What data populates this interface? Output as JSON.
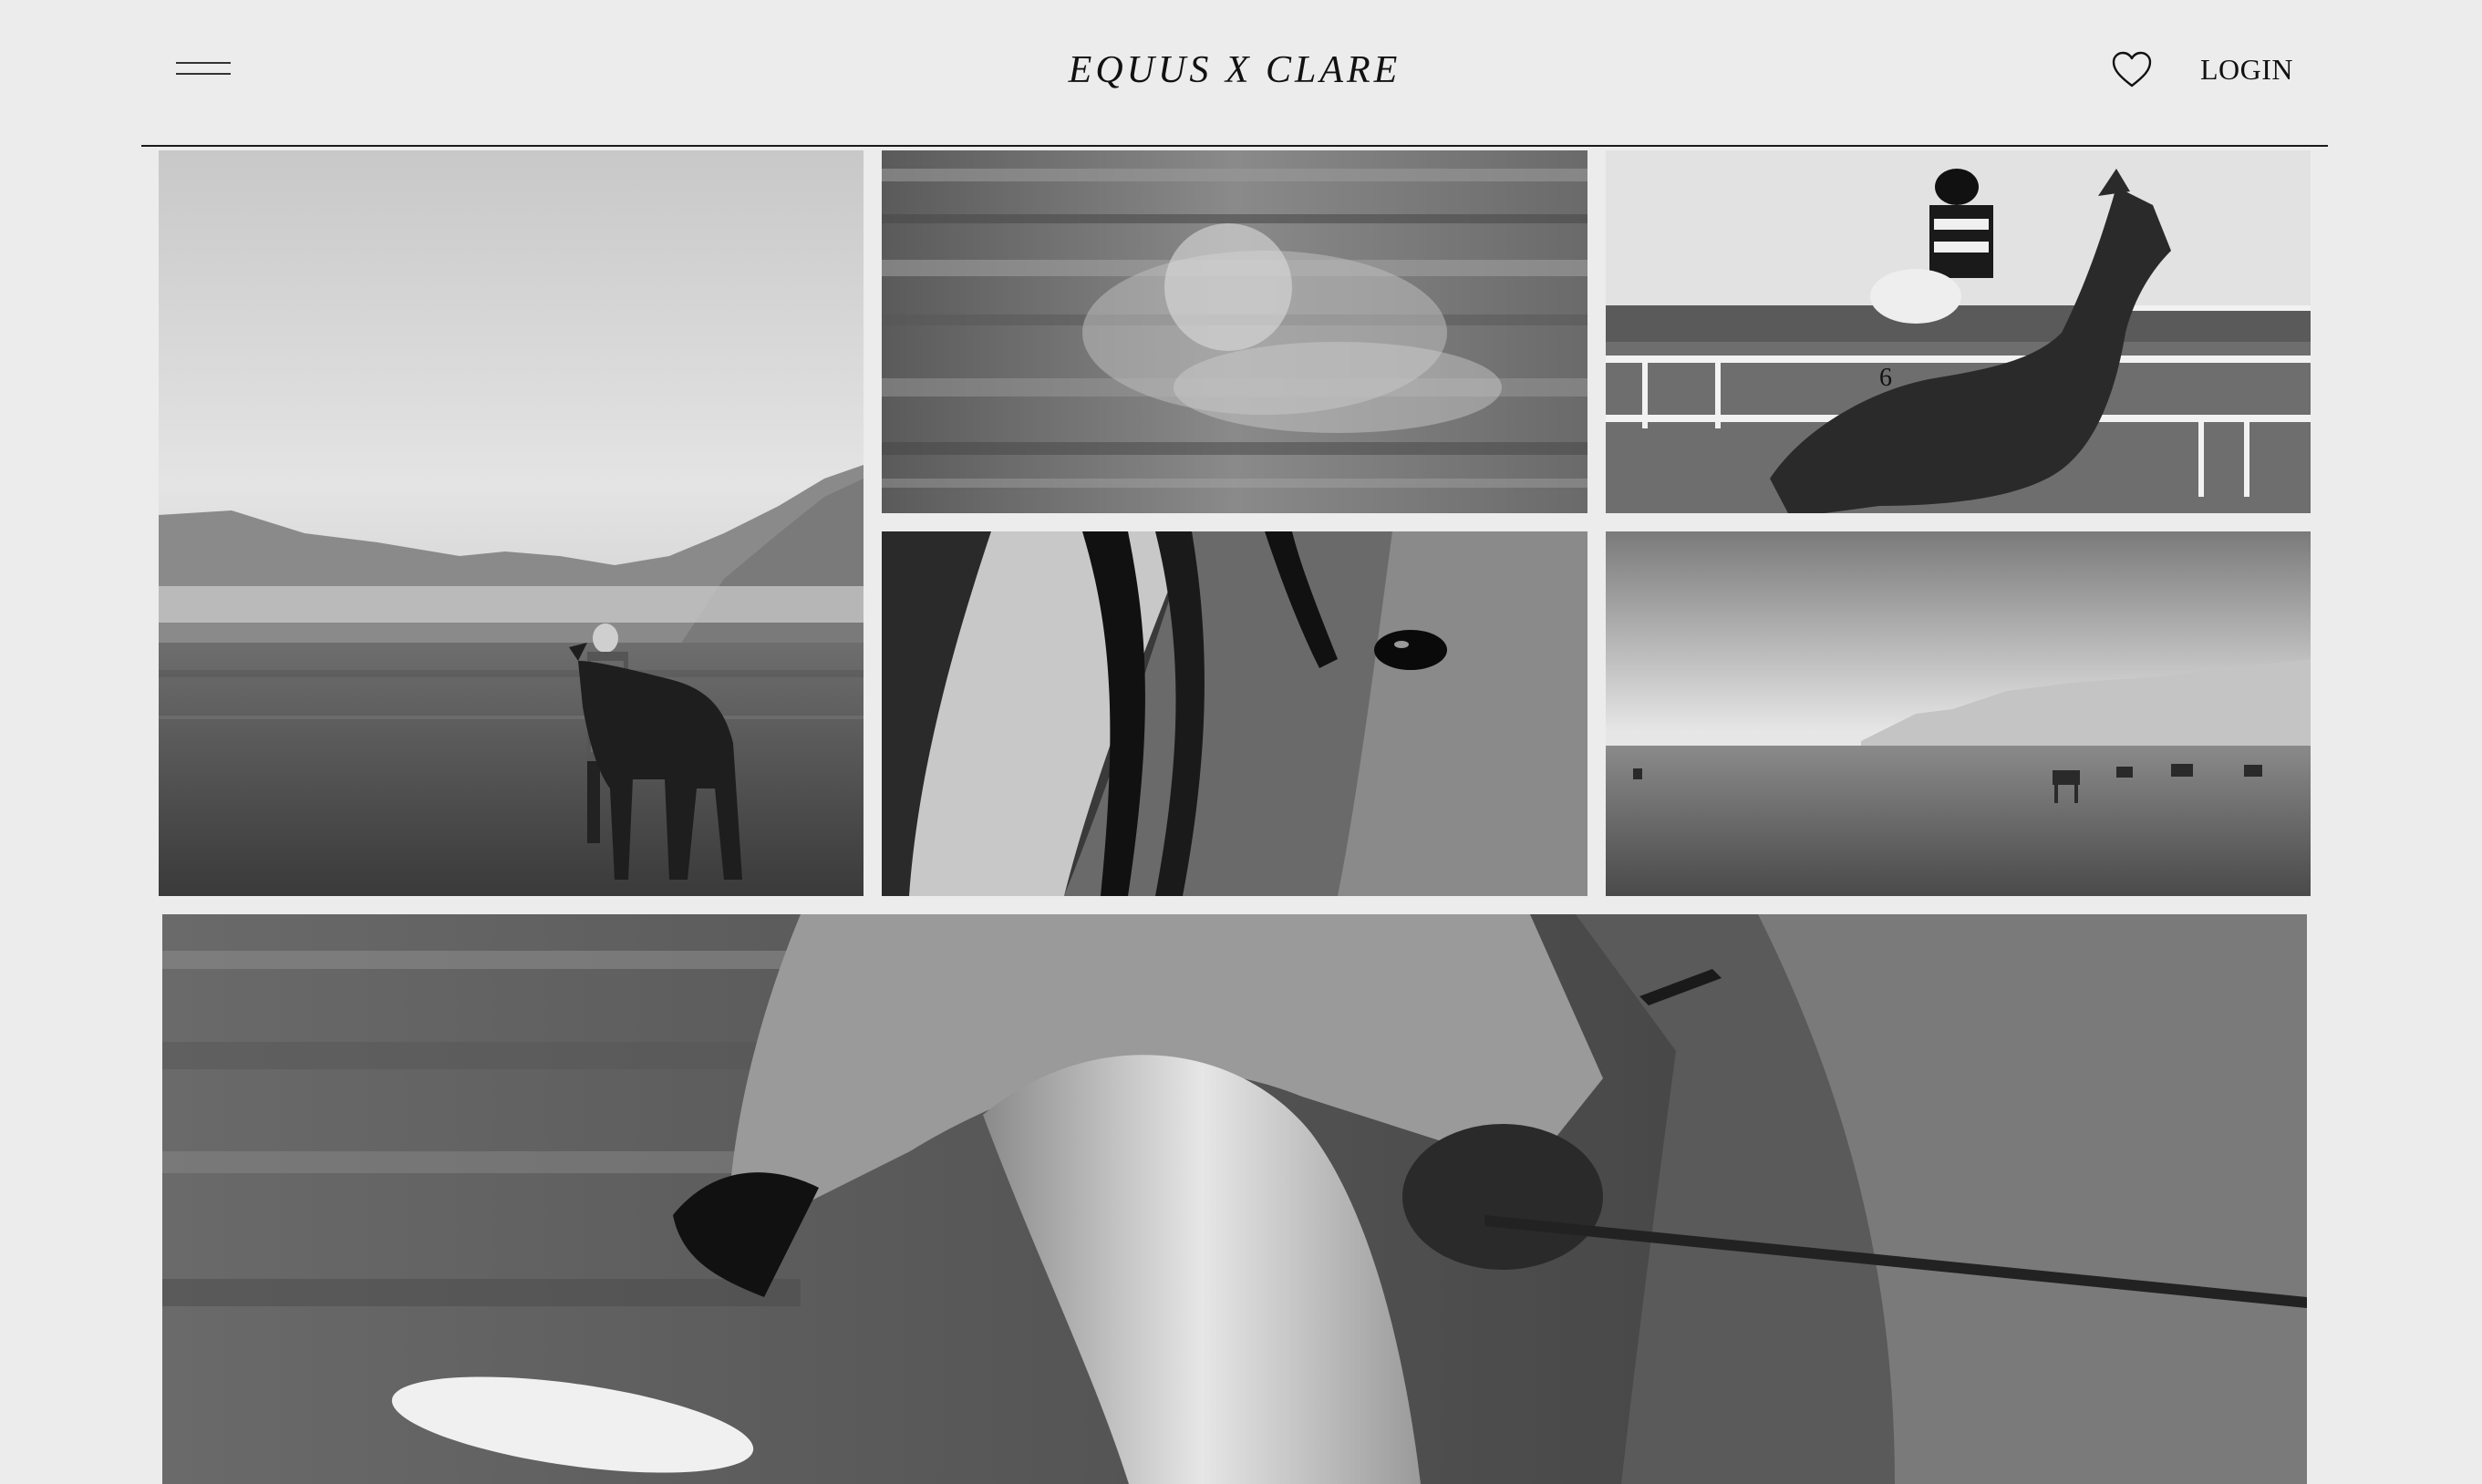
{
  "header": {
    "brand": "EQUUS X CLARE",
    "login_label": "LOGIN",
    "menu_icon": "hamburger-menu-icon",
    "favorites_icon": "heart-icon"
  },
  "gallery": {
    "photos": [
      {
        "subject": "rider-walking-horse-in-misty-valley"
      },
      {
        "subject": "motion-blurred-racing-jockey"
      },
      {
        "subject": "jockey-number-6-racing-horse"
      },
      {
        "subject": "close-up-horse-eye-and-mane"
      },
      {
        "subject": "horses-grazing-in-foggy-field"
      },
      {
        "subject": "close-up-rider-arm-on-galloping-horse"
      }
    ]
  },
  "colors": {
    "background": "#ececec",
    "text": "#111111",
    "divider": "#1a1a1a"
  }
}
